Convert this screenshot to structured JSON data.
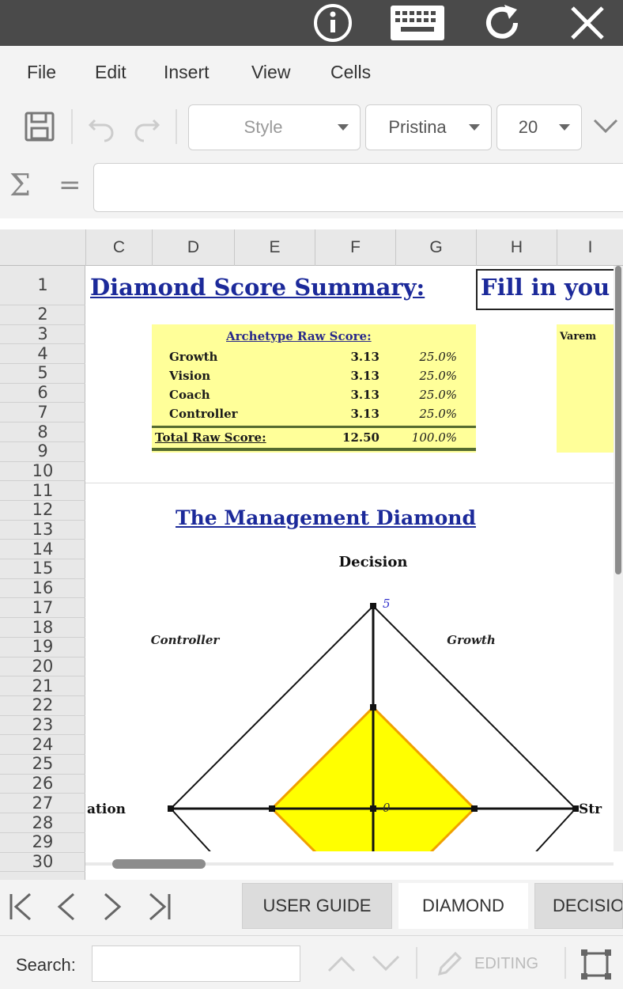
{
  "topbar": {
    "buttons": [
      {
        "name": "info-icon"
      },
      {
        "name": "keyboard-icon"
      },
      {
        "name": "refresh-icon"
      },
      {
        "name": "close-icon"
      }
    ]
  },
  "menu": {
    "file": "File",
    "edit": "Edit",
    "insert": "Insert",
    "view": "View",
    "cells": "Cells"
  },
  "toolbar": {
    "style_value": "Style",
    "font_value": "Pristina",
    "size_value": "20"
  },
  "formula": {
    "sigma": "Σ",
    "equals": "=",
    "value": ""
  },
  "columns": [
    "C",
    "D",
    "E",
    "F",
    "G",
    "H",
    "I"
  ],
  "rows": [
    "1",
    "2",
    "3",
    "4",
    "5",
    "6",
    "7",
    "8",
    "9",
    "10",
    "11",
    "12",
    "13",
    "14",
    "15",
    "16",
    "17",
    "18",
    "19",
    "20",
    "21",
    "22",
    "23",
    "24",
    "25",
    "26",
    "27",
    "28",
    "29",
    "30"
  ],
  "sheet": {
    "title": "Diamond Score Summary:",
    "h1_text": "Fill in you",
    "scorebox": {
      "header": "Archetype Raw Score:",
      "rows": [
        {
          "label": "Growth",
          "value": "3.13",
          "pct": "25.0%"
        },
        {
          "label": "Vision",
          "value": "3.13",
          "pct": "25.0%"
        },
        {
          "label": "Coach",
          "value": "3.13",
          "pct": "25.0%"
        },
        {
          "label": "Controller",
          "value": "3.13",
          "pct": "25.0%"
        }
      ],
      "total_label": "Total Raw Score:",
      "total_value": "12.50",
      "total_pct": "100.0%"
    },
    "scorebox2_header": "Varem"
  },
  "chart_data": {
    "type": "radar",
    "title": "The Management Diamond",
    "axes": {
      "top": "Decision",
      "left": "ation",
      "right": "Str"
    },
    "quadrant_labels": {
      "top_left": "Controller",
      "top_right": "Growth"
    },
    "tick_labels": {
      "max": "5",
      "center": "0"
    },
    "range": [
      0,
      5
    ],
    "series": [
      {
        "values": [
          2.5,
          2.5,
          2.5,
          2.5
        ],
        "color": "#ffff00",
        "stroke": "#f0a000"
      }
    ]
  },
  "tabs": {
    "user_guide": "USER GUIDE",
    "diamond": "DIAMOND",
    "decision": "DECISIO"
  },
  "status": {
    "search_label": "Search:",
    "search_value": "",
    "editing": "EDITING"
  }
}
